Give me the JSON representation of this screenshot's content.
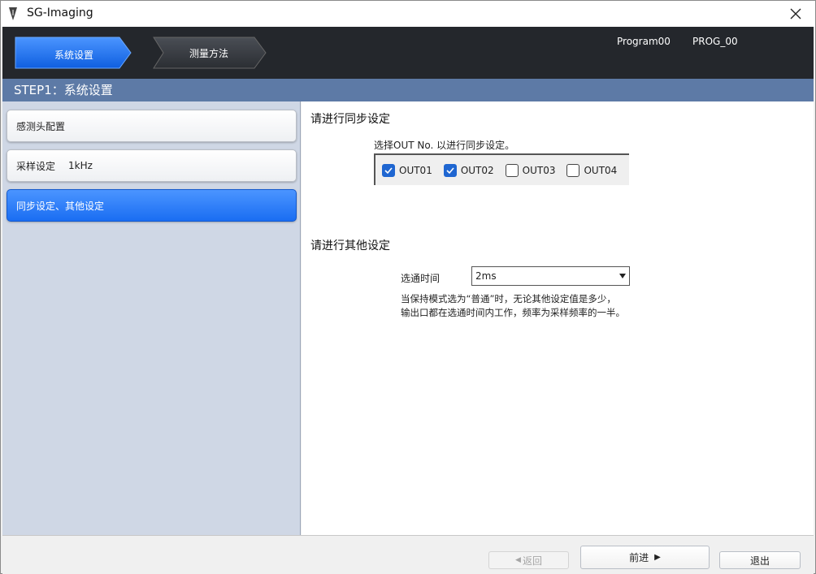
{
  "window": {
    "title": "SG-Imaging",
    "app_icon": "pen-nib-icon",
    "close_icon": "close-icon"
  },
  "steps": [
    {
      "label": "系统设置",
      "active": true
    },
    {
      "label": "测量方法",
      "active": false
    }
  ],
  "header_info": {
    "program": "Program00",
    "prog_id": "PROG_00"
  },
  "step_title": "STEP1：系统设置",
  "nav": {
    "items": [
      {
        "label": "感测头配置",
        "value": ""
      },
      {
        "label": "采样设定",
        "value": "1kHz"
      },
      {
        "label": "同步设定、其他设定",
        "value": ""
      }
    ]
  },
  "sync": {
    "title": "请进行同步设定",
    "hint": "选择OUT No. 以进行同步设定。",
    "outputs": [
      {
        "label": "OUT01",
        "checked": true
      },
      {
        "label": "OUT02",
        "checked": true
      },
      {
        "label": "OUT03",
        "checked": false
      },
      {
        "label": "OUT04",
        "checked": false
      }
    ]
  },
  "other": {
    "title": "请进行其他设定",
    "pass_time_label": "选通时间",
    "pass_time_value": "2ms",
    "note_line1": "当保持模式选为“普通”时，无论其他设定值是多少，",
    "note_line2": "输出口都在选通时间内工作，频率为采样频率的一半。"
  },
  "footer": {
    "back_label": "返回",
    "back_arrow": "◀",
    "next_label": "前进",
    "next_arrow": "▶",
    "exit_label": "退出"
  },
  "colors": {
    "header_bg": "#24272c",
    "step_title_bg": "#5d7aa6",
    "left_panel_bg": "#cfd7e5",
    "accent_blue": "#1a6df2",
    "checkbox_blue": "#1f66d1"
  }
}
